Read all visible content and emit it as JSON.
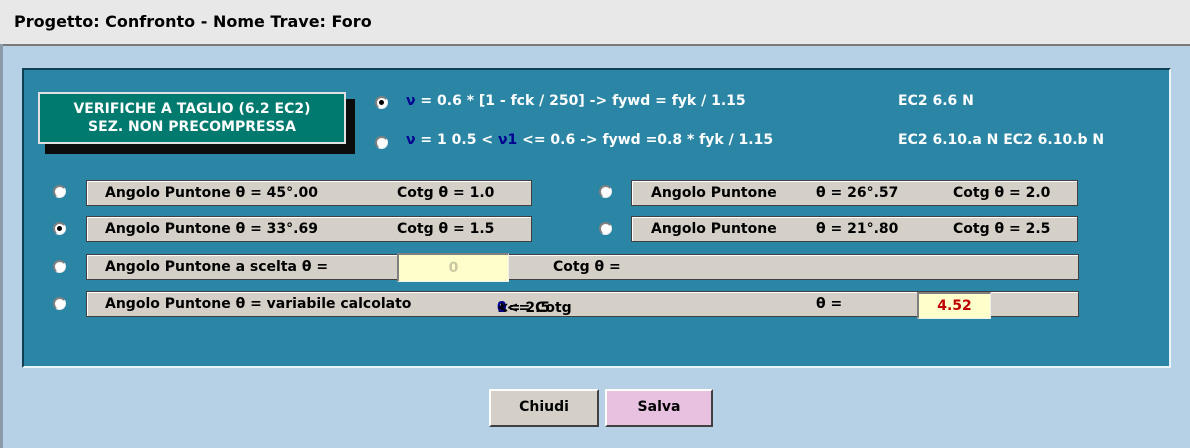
{
  "window": {
    "title": "Progetto: Confronto - Nome Trave: Foro"
  },
  "badge": {
    "line1": "VERIFICHE A TAGLIO (6.2 EC2)",
    "line2": "SEZ. NON PRECOMPRESSA"
  },
  "options_v": [
    {
      "nu": "ν",
      "formula": " = 0.6 *  [1 - fck / 250]  -> fywd = fyk / 1.15",
      "ref": "EC2 6.6 N",
      "checked": true
    },
    {
      "nu": "ν",
      "formula_a": " = ",
      "nu1": "ν1",
      "formula_b": "1   0.5 <  ",
      "nu2": "ν1",
      "formula_c": " <= 0.6 -> fywd =0.8 *  fyk / 1.15",
      "ref": "EC2 6.10.a N   EC2 6.10.b N",
      "checked": false
    }
  ],
  "strut_options": {
    "opt1": {
      "label": "Angolo Puntone  θ  = 45°.00",
      "cotg": "Cotg  θ = 1.0",
      "checked": false
    },
    "opt2": {
      "label": "Angolo Puntone  θ  = 33°.69",
      "cotg": "Cotg  θ = 1.5",
      "checked": true
    },
    "opt3": {
      "label": "Angolo Puntone",
      "theta": "θ  = 26°.57",
      "cotg": "Cotg  θ = 2.0",
      "checked": false
    },
    "opt4": {
      "label": "Angolo Puntone",
      "theta": "θ  = 21°.80",
      "cotg": "Cotg  θ = 2.5",
      "checked": false
    },
    "opt5": {
      "label": "Angolo Puntone a scelta   θ =",
      "value": "0",
      "cotg": "Cotg   θ =",
      "checked": false
    },
    "opt6": {
      "label": "Angolo Puntone  θ  = variabile calcolato",
      "range_a": "1<= Cotg",
      "range_theta": "θ",
      "range_b": " <= 2.5",
      "theta_label": "θ  =",
      "value": "4.52",
      "checked": false
    }
  },
  "buttons": {
    "close": "Chiudi",
    "save": "Salva"
  },
  "colors": {
    "panel": "#2b86a6",
    "badge": "#007a6e",
    "field_value_red": "#c00000",
    "save_button": "#e8c0e0",
    "close_button": "#d4d0c8"
  }
}
